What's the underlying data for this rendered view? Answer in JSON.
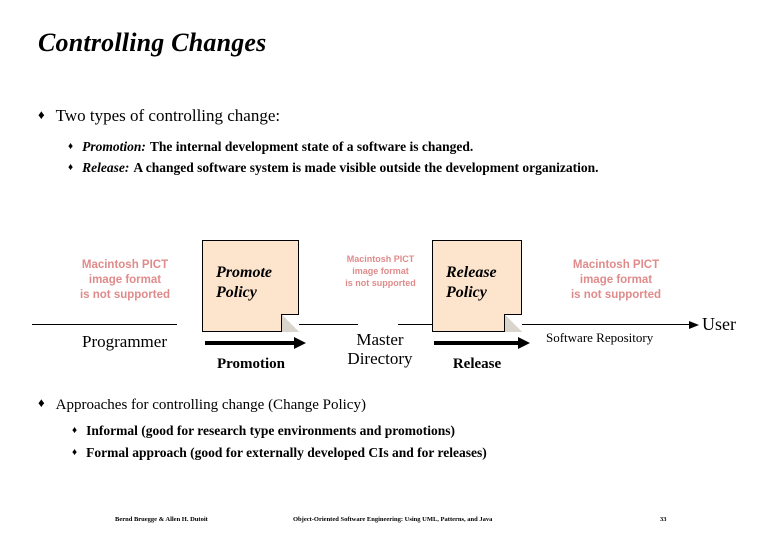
{
  "slide": {
    "title": "Controlling Changes",
    "page_number": "33"
  },
  "bullets": {
    "first": {
      "marker": "♦",
      "text": "Two types of controlling change:",
      "sub": [
        {
          "marker": "♦",
          "term": "Promotion:",
          "text": "The internal development state of a software is changed."
        },
        {
          "marker": "♦",
          "term": "Release:",
          "text": "A changed software system is made visible outside the development organization."
        }
      ]
    },
    "second": {
      "marker": "♦",
      "text": "Approaches for controlling change (Change Policy)",
      "sub": [
        {
          "marker": "♦",
          "text": "Informal (good for research type environments and promotions)"
        },
        {
          "marker": "♦",
          "text": "Formal approach (good for externally developed CIs and for releases)"
        }
      ]
    }
  },
  "diagram": {
    "placeholder_text": "Macintosh PICT\nimage format\nis not supported",
    "placeholder_color": "#e08b8b",
    "policy_fill": "#fce4cd",
    "placeholders": [
      {
        "name": "programmer-image",
        "lines": [
          "Macintosh PICT",
          "image format",
          "is not supported"
        ]
      },
      {
        "name": "master-directory-image",
        "lines": [
          "Macintosh PICT",
          "image format",
          "is not supported"
        ]
      },
      {
        "name": "software-repository-image",
        "lines": [
          "Macintosh PICT",
          "image format",
          "is not supported"
        ]
      }
    ],
    "policies": [
      {
        "name": "promote-policy",
        "line1": "Promote",
        "line2": "Policy"
      },
      {
        "name": "release-policy",
        "line1": "Release",
        "line2": "Policy"
      }
    ],
    "nodes": [
      {
        "name": "programmer",
        "label": "Programmer"
      },
      {
        "name": "master-directory",
        "line1": "Master",
        "line2": "Directory"
      },
      {
        "name": "user",
        "label": "User"
      }
    ],
    "flows": [
      {
        "name": "promotion-arrow",
        "label": "Promotion"
      },
      {
        "name": "release-arrow",
        "label": "Release"
      }
    ],
    "repository_label": "Software Repository"
  },
  "footer": {
    "authors": "Bernd Bruegge & Allen H. Dutoit",
    "book": "Object-Oriented Software Engineering: Using UML, Patterns, and Java",
    "page": "33"
  }
}
